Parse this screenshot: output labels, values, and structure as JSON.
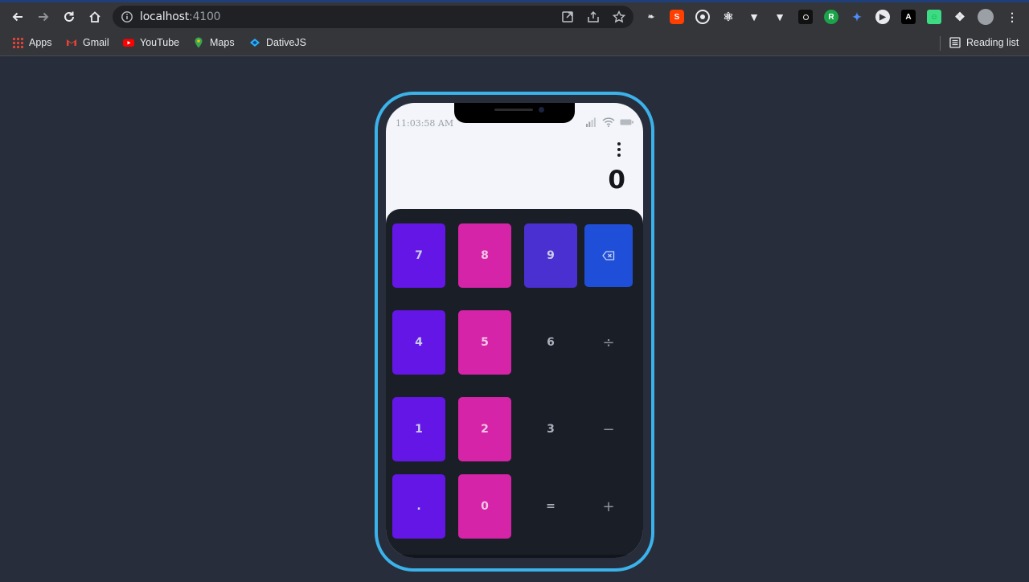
{
  "browser": {
    "url_host": "localhost",
    "url_port": ":4100",
    "bookmarks": [
      {
        "label": "Apps",
        "icon": "apps-grid-icon"
      },
      {
        "label": "Gmail",
        "icon": "gmail-icon"
      },
      {
        "label": "YouTube",
        "icon": "youtube-icon"
      },
      {
        "label": "Maps",
        "icon": "maps-icon"
      },
      {
        "label": "DativeJS",
        "icon": "dativejs-icon"
      }
    ],
    "reading_list": "Reading list"
  },
  "phone": {
    "time": "11:03:58 AM",
    "display_value": "0",
    "keys": [
      {
        "label": "7",
        "style": "violet"
      },
      {
        "label": "8",
        "style": "pink"
      },
      {
        "label": "9",
        "style": "indigo"
      },
      {
        "label": "",
        "style": "blue",
        "icon": "backspace-icon"
      },
      {
        "label": "4",
        "style": "violet"
      },
      {
        "label": "5",
        "style": "pink"
      },
      {
        "label": "6",
        "style": "plain"
      },
      {
        "label": "÷",
        "style": "op"
      },
      {
        "label": "1",
        "style": "violet"
      },
      {
        "label": "2",
        "style": "pink"
      },
      {
        "label": "3",
        "style": "plain"
      },
      {
        "label": "−",
        "style": "op"
      },
      {
        "label": ".",
        "style": "violet"
      },
      {
        "label": "0",
        "style": "pink"
      },
      {
        "label": "=",
        "style": "plain"
      },
      {
        "label": "+",
        "style": "op"
      }
    ]
  },
  "colors": {
    "page_background": "#272d3a",
    "phone_frame": "#3bb2ea",
    "violet_key": "#6416e6",
    "pink_key": "#d524a8",
    "indigo_key": "#4a2fd1",
    "blue_key": "#1f4fd8"
  }
}
